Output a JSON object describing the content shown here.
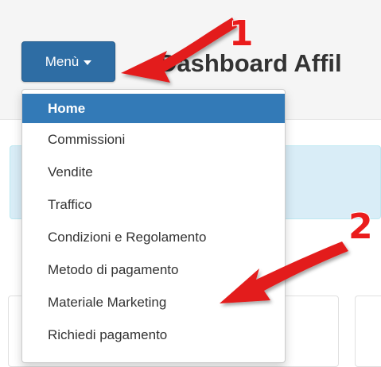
{
  "header": {
    "menu_button_label": "Menù",
    "page_title": "Dashboard Affil"
  },
  "dropdown": {
    "items": [
      {
        "label": "Home",
        "active": true
      },
      {
        "label": "Commissioni",
        "active": false
      },
      {
        "label": "Vendite",
        "active": false
      },
      {
        "label": "Traffico",
        "active": false
      },
      {
        "label": "Condizioni e Regolamento",
        "active": false
      },
      {
        "label": "Metodo di pagamento",
        "active": false
      },
      {
        "label": "Materiale Marketing",
        "active": false
      },
      {
        "label": "Richiedi pagamento",
        "active": false
      }
    ]
  },
  "annotations": {
    "callout_1": "1",
    "callout_2": "2",
    "arrow_color": "#e31b1b"
  },
  "colors": {
    "button_primary": "#2e6da4",
    "active_item": "#337ab7",
    "alert_bg": "#d9edf7"
  }
}
